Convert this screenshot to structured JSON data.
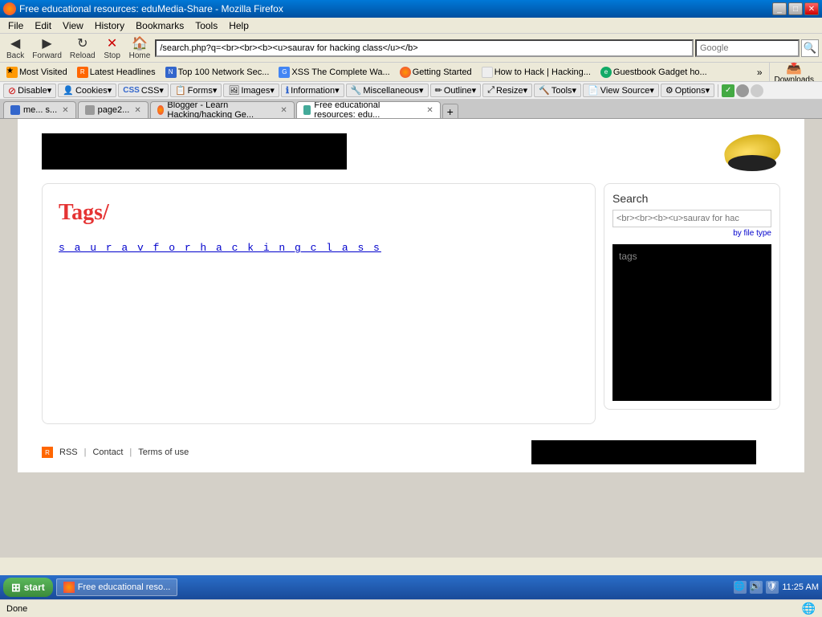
{
  "titlebar": {
    "title": "Free educational resources: eduMedia-Share - Mozilla Firefox",
    "icon": "firefox-icon"
  },
  "menubar": {
    "items": [
      "File",
      "Edit",
      "View",
      "History",
      "Bookmarks",
      "Tools",
      "Help"
    ]
  },
  "navbar": {
    "back_label": "Back",
    "forward_label": "Forward",
    "reload_label": "Reload",
    "stop_label": "Stop",
    "home_label": "Home",
    "address": "/search.php?q=<br><br><b><u>saurav for hacking class</u></b>",
    "search_placeholder": "Google",
    "go_label": "▶"
  },
  "bookmarks": {
    "items": [
      {
        "label": "Most Visited",
        "icon": "star-icon"
      },
      {
        "label": "Latest Headlines",
        "icon": "rss-icon"
      },
      {
        "label": "Top 100 Network Sec...",
        "icon": "network-icon"
      },
      {
        "label": "XSS The Complete Wa...",
        "icon": "google-icon"
      },
      {
        "label": "Getting Started",
        "icon": "firefox-icon"
      },
      {
        "label": "How to Hack | Hacking...",
        "icon": "page-icon"
      },
      {
        "label": "Guestbook Gadget ho...",
        "icon": "ie-icon"
      }
    ],
    "more_label": "»",
    "downloads_label": "Downloads"
  },
  "devbar": {
    "items": [
      {
        "label": "Disable▾",
        "icon": "disable-icon"
      },
      {
        "label": "Cookies▾",
        "icon": "cookie-icon"
      },
      {
        "label": "CSS▾",
        "icon": "css-icon"
      },
      {
        "label": "Forms▾",
        "icon": "forms-icon"
      },
      {
        "label": "Images▾",
        "icon": "images-icon"
      },
      {
        "label": "Information▾",
        "icon": "info-icon"
      },
      {
        "label": "Miscellaneous▾",
        "icon": "misc-icon"
      },
      {
        "label": "Outline▾",
        "icon": "outline-icon"
      },
      {
        "label": "Resize▾",
        "icon": "resize-icon"
      },
      {
        "label": "Tools▾",
        "icon": "tools-icon"
      },
      {
        "label": "View Source▾",
        "icon": "source-icon"
      },
      {
        "label": "Options▾",
        "icon": "options-icon"
      }
    ]
  },
  "tabs": [
    {
      "label": "me... s...",
      "active": false,
      "icon": "page-icon"
    },
    {
      "label": "page2...",
      "active": false,
      "icon": "page-icon"
    },
    {
      "label": "Blogger - Learn Hacking/hacking Ge...",
      "active": false,
      "icon": "blogger-icon"
    },
    {
      "label": "Free educational resources: edu...",
      "active": true,
      "icon": "edumedia-icon"
    }
  ],
  "page": {
    "tags_heading": "Tags/",
    "search_result_link": "s a u r a v  f o r  h a c k i n g  c l a s s",
    "search_label": "Search",
    "search_query": "<br><br><b><u>saurav for hac",
    "search_by_filetype": "by file type",
    "browse_tags_label": "tags",
    "footer": {
      "rss_label": "RSS",
      "contact_label": "Contact",
      "terms_label": "Terms of use"
    }
  },
  "statusbar": {
    "status_text": "Done",
    "globe_icon": "globe-icon"
  },
  "taskbar": {
    "start_label": "start",
    "window_label": "Free educational reso...",
    "time": "11:25 AM"
  }
}
